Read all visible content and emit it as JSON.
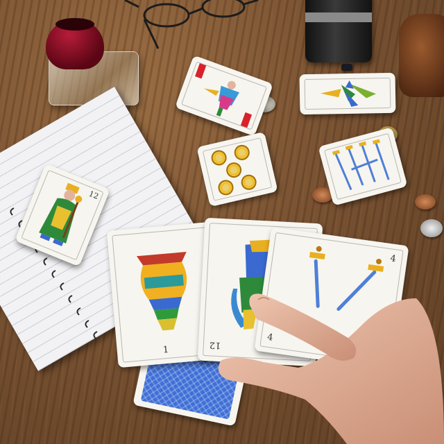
{
  "scene": {
    "description_ids": [
      "wooden-table",
      "spanish-playing-cards",
      "notebook",
      "perfume-bottle",
      "eyeglasses",
      "coins",
      "hand"
    ],
    "colors": {
      "table": "#7a5333",
      "card_face": "#f7f5ef",
      "card_back": "#3f6fd6",
      "skin": "#e2b49c",
      "perfume_cap": "#7a0f22",
      "gold": "#e8b020",
      "sword_blue": "#4f7fd8"
    }
  },
  "cards": {
    "king_cups": {
      "index_top": "12",
      "icon": "king-card"
    },
    "jack_cups_red": {
      "icon": "jack-card"
    },
    "five_coins": {
      "icon": "five-of-coins-card"
    },
    "seven_swords": {
      "icon": "seven-of-swords-card"
    },
    "ace_clubs_top": {
      "icon": "four-of-clubs-card"
    },
    "hand_ace_cups": {
      "index": "1",
      "icon": "ace-of-cups-card"
    },
    "hand_king_12": {
      "index": "12",
      "icon": "twelve-card"
    },
    "hand_four_swords": {
      "index_top": "4",
      "index_bottom": "4",
      "icon": "four-of-swords-card"
    },
    "card_back": {
      "icon": "card-back"
    }
  }
}
